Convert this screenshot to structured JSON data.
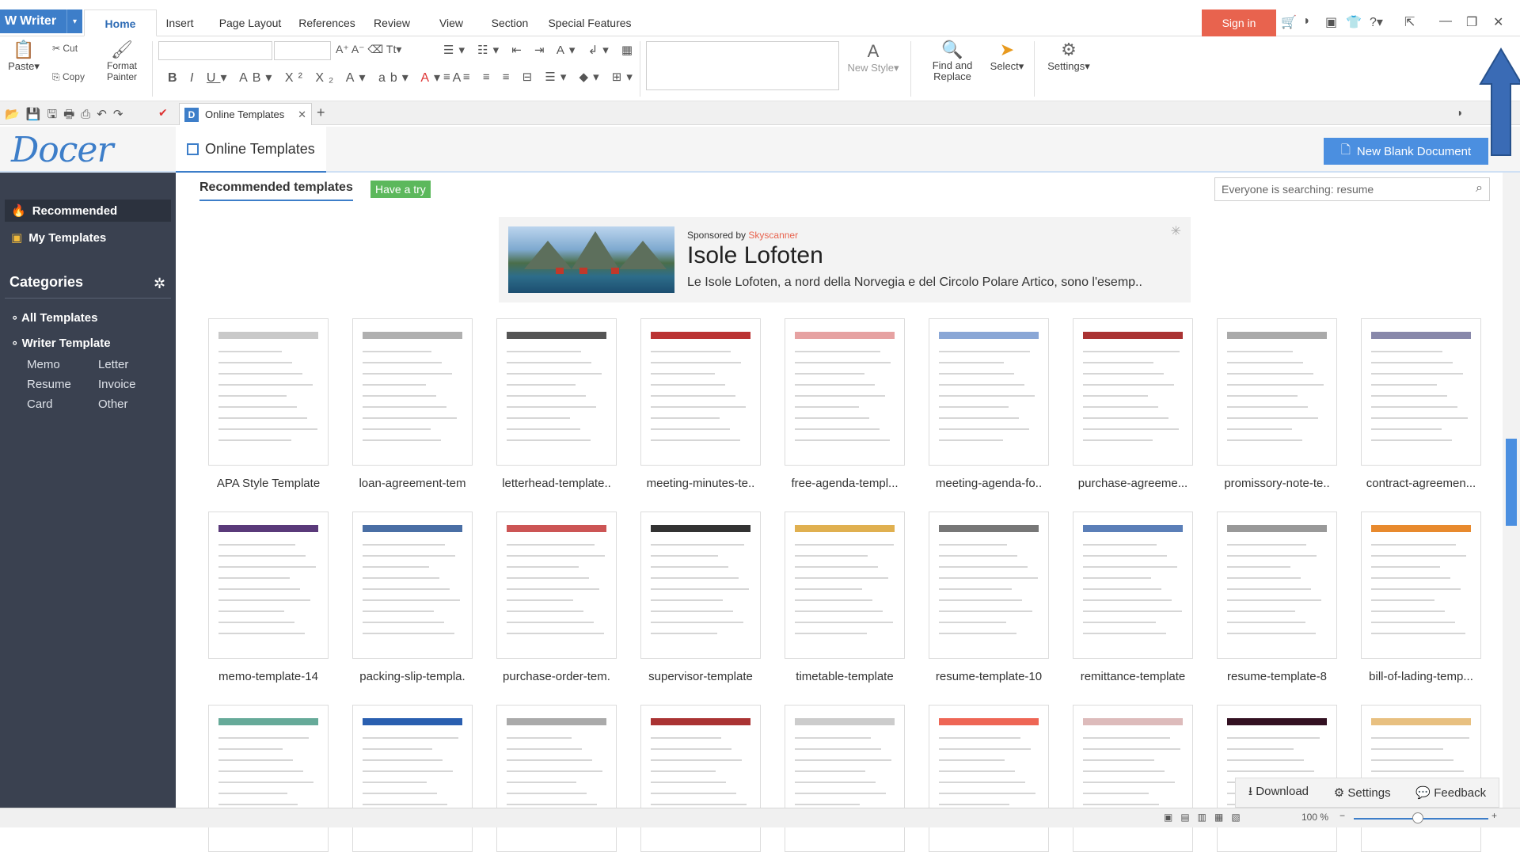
{
  "app": {
    "name": "Writer"
  },
  "menu": {
    "tabs": [
      "Home",
      "Insert",
      "Page Layout",
      "References",
      "Review",
      "View",
      "Section",
      "Special Features"
    ]
  },
  "titlebar": {
    "sign_in": "Sign in"
  },
  "ribbon": {
    "paste": "Paste",
    "cut": "Cut",
    "copy": "Copy",
    "format_painter": "Format Painter",
    "new_style": "New Style",
    "find_replace": "Find and Replace",
    "select": "Select",
    "settings": "Settings"
  },
  "doc_tab": {
    "title": "Online Templates"
  },
  "docer": {
    "logo": "Docer",
    "tab": "Online Templates",
    "new_blank": "New Blank Document"
  },
  "sidebar": {
    "recommended": "Recommended",
    "my_templates": "My Templates",
    "categories": "Categories",
    "all_templates": "All Templates",
    "writer_template": "Writer Template",
    "subcats": [
      "Memo",
      "Letter",
      "Resume",
      "Invoice",
      "Card",
      "Other"
    ]
  },
  "main": {
    "rec_tab": "Recommended templates",
    "have_try": "Have a try",
    "search_placeholder": "Everyone is searching: resume"
  },
  "ad": {
    "sponsored_by": "Sponsored by",
    "brand": "Skyscanner",
    "title": "Isole Lofoten",
    "desc": "Le Isole Lofoten, a nord della Norvegia e del Circolo Polare Artico, sono l'esemp.."
  },
  "templates": [
    "APA Style Template",
    "loan-agreement-tem",
    "letterhead-template..",
    "meeting-minutes-te..",
    "free-agenda-templ...",
    "meeting-agenda-fo..",
    "purchase-agreeme...",
    "promissory-note-te..",
    "contract-agreemen...",
    "memo-template-14",
    "packing-slip-templa.",
    "purchase-order-tem.",
    "supervisor-template",
    "timetable-template",
    "resume-template-10",
    "remittance-template",
    "resume-template-8",
    "bill-of-lading-temp...",
    "",
    "",
    "",
    "",
    "",
    "",
    "",
    "",
    ""
  ],
  "bottom": {
    "download": "Download",
    "settings": "Settings",
    "feedback": "Feedback"
  },
  "status": {
    "zoom": "100 %"
  }
}
